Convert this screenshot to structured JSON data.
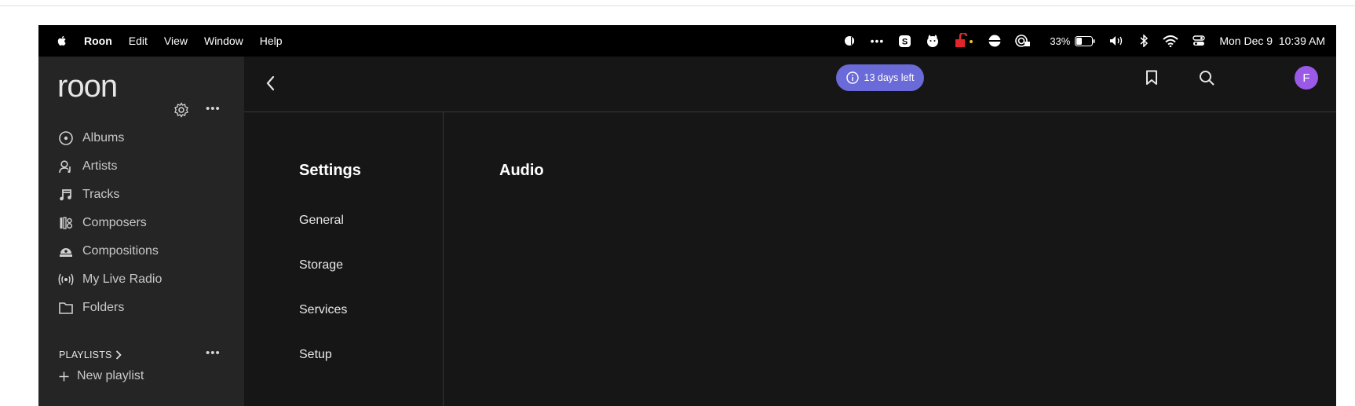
{
  "menubar": {
    "app_name": "Roon",
    "menus": [
      "Edit",
      "View",
      "Window",
      "Help"
    ],
    "battery_percent": "33%",
    "datetime": "Mon Dec 9  10:39 AM"
  },
  "sidebar": {
    "logo": "roon",
    "items": [
      {
        "label": "Albums",
        "icon": "album-icon"
      },
      {
        "label": "Artists",
        "icon": "artist-icon"
      },
      {
        "label": "Tracks",
        "icon": "music-note-icon"
      },
      {
        "label": "Composers",
        "icon": "composer-icon"
      },
      {
        "label": "Compositions",
        "icon": "composition-icon"
      },
      {
        "label": "My Live Radio",
        "icon": "radio-icon"
      },
      {
        "label": "Folders",
        "icon": "folder-icon"
      }
    ],
    "playlists_header": "PLAYLISTS",
    "new_playlist": "New playlist"
  },
  "topbar": {
    "trial_badge": "13 days left",
    "avatar_initial": "F"
  },
  "settings": {
    "title": "Settings",
    "links": [
      "General",
      "Storage",
      "Services",
      "Setup"
    ]
  },
  "content": {
    "title": "Audio"
  },
  "colors": {
    "background": "#161616",
    "sidebar": "#252525",
    "trial_badge": "#6a6ad8",
    "avatar": "#9b59e8"
  }
}
